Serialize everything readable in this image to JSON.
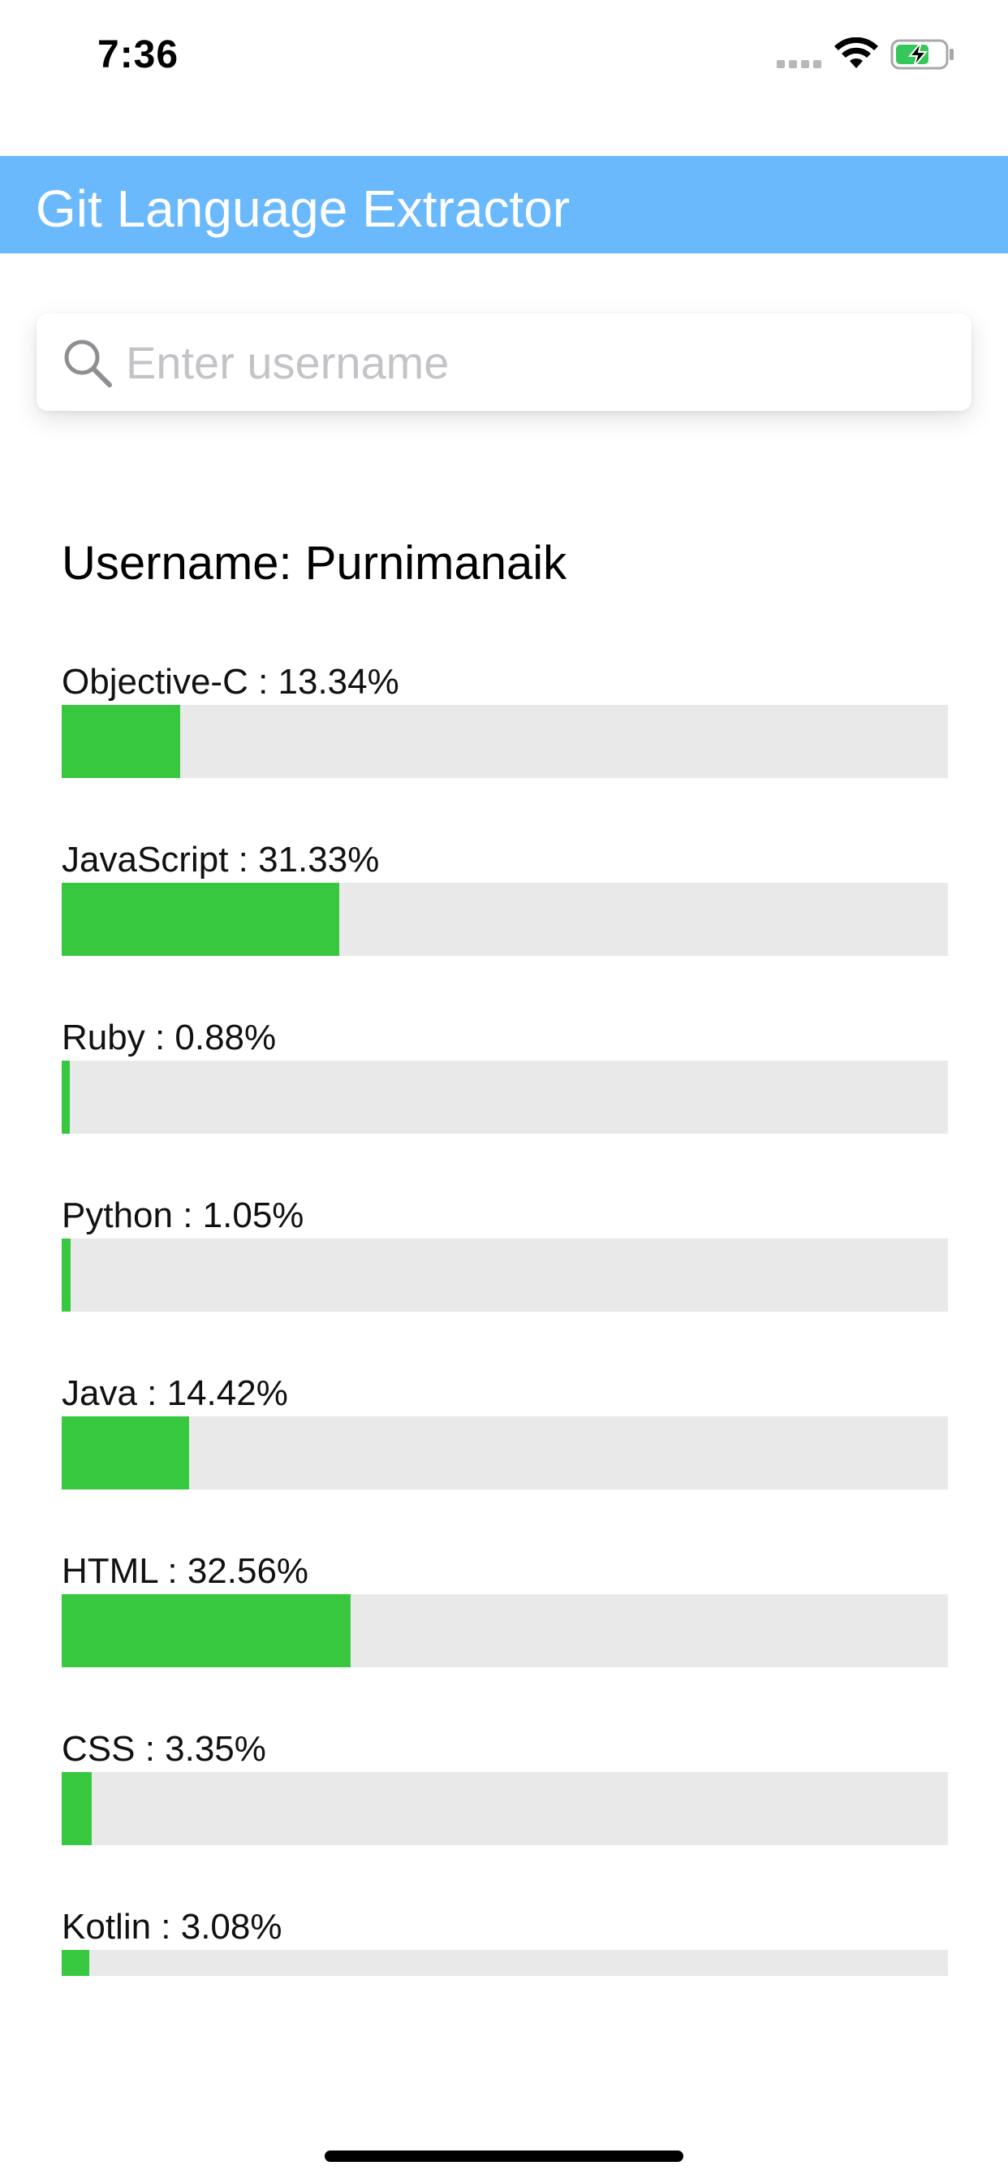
{
  "status_bar": {
    "time": "7:36",
    "icons": [
      "signal-dots-icon",
      "wifi-icon",
      "battery-charging-icon"
    ],
    "battery_color": "#35c759"
  },
  "header": {
    "title": "Git Language Extractor",
    "background_color": "#6bb9fd"
  },
  "search": {
    "placeholder": "Enter username",
    "value": "",
    "icon": "search-icon"
  },
  "username_label": "Username: Purnimanaik",
  "languages": [
    {
      "label": "Objective-C : 13.34%",
      "percent": 13.34
    },
    {
      "label": "JavaScript : 31.33%",
      "percent": 31.33
    },
    {
      "label": "Ruby : 0.88%",
      "percent": 0.88
    },
    {
      "label": "Python : 1.05%",
      "percent": 1.05
    },
    {
      "label": "Java : 14.42%",
      "percent": 14.42
    },
    {
      "label": "HTML : 32.56%",
      "percent": 32.56
    },
    {
      "label": "CSS : 3.35%",
      "percent": 3.35
    },
    {
      "label": "Kotlin : 3.08%",
      "percent": 3.08
    }
  ],
  "colors": {
    "bar_fill": "#37c83f",
    "bar_track": "#e9e9e9"
  }
}
